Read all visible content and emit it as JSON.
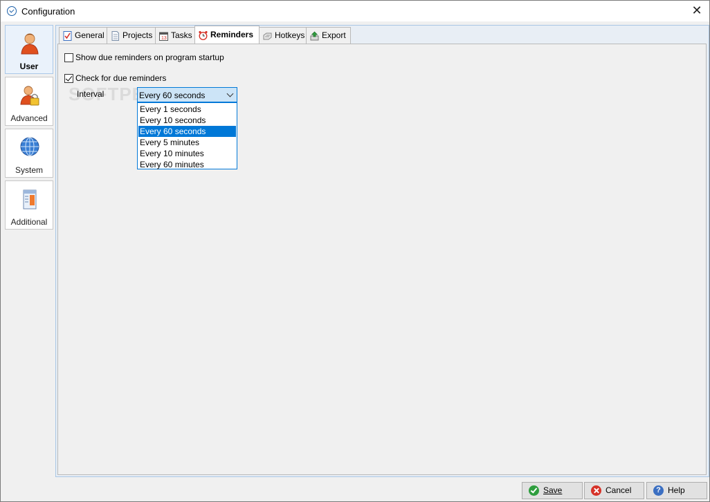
{
  "window": {
    "title": "Configuration",
    "close_glyph": "✕"
  },
  "sidebar": {
    "items": [
      {
        "label": "User",
        "icon": "user-icon",
        "active": true
      },
      {
        "label": "Advanced",
        "icon": "user-lock-icon",
        "active": false
      },
      {
        "label": "System",
        "icon": "globe-icon",
        "active": false
      },
      {
        "label": "Additional",
        "icon": "server-icon",
        "active": false
      }
    ]
  },
  "tabs": [
    {
      "label": "General",
      "icon": "checklist-icon",
      "active": false
    },
    {
      "label": "Projects",
      "icon": "document-icon",
      "active": false
    },
    {
      "label": "Tasks",
      "icon": "calendar-icon",
      "active": false
    },
    {
      "label": "Reminders",
      "icon": "alarm-clock-icon",
      "active": true
    },
    {
      "label": "Hotkeys",
      "icon": "keyboard-icon",
      "active": false
    },
    {
      "label": "Export",
      "icon": "export-icon",
      "active": false
    }
  ],
  "reminders": {
    "show_on_startup": {
      "label": "Show due reminders on program startup",
      "checked": false
    },
    "check_due": {
      "label": "Check for due reminders",
      "checked": true
    },
    "interval": {
      "label": "Interval",
      "value": "Every 60 seconds",
      "options": [
        "Every 1 seconds",
        "Every 10 seconds",
        "Every 60 seconds",
        "Every 5 minutes",
        "Every 10 minutes",
        "Every 60 minutes"
      ],
      "selected_index": 2
    }
  },
  "watermark": "SOFTPEDIA",
  "footer": {
    "save_label": "Save",
    "cancel_label": "Cancel",
    "help_label": "Help",
    "help_glyph": "?"
  },
  "colors": {
    "accent": "#0078d7",
    "selection_bg": "#0078d7",
    "combo_bg": "#cce4f7",
    "frame_border": "#a9c6e4"
  }
}
